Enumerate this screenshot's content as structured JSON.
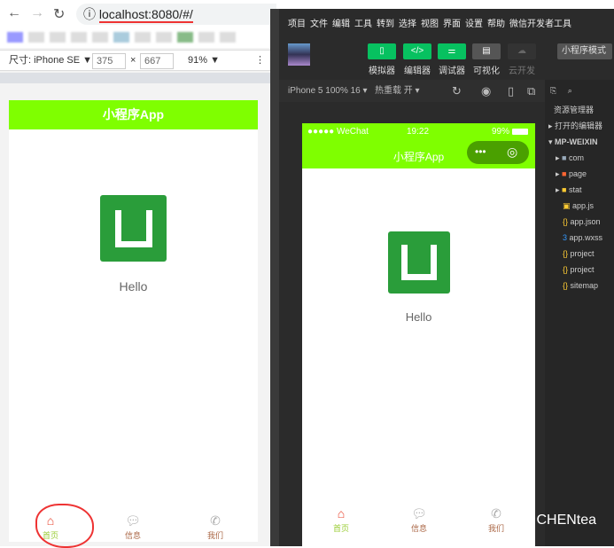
{
  "browser": {
    "url": "localhost:8080/#/",
    "device_label": "尺寸: iPhone SE ▼",
    "width": "375",
    "times": "×",
    "height": "667",
    "zoom": "91% ▼",
    "more": "⋮"
  },
  "app": {
    "title": "小程序App",
    "hello": "Hello",
    "tabs": [
      {
        "label": "首页",
        "icon": "home-icon"
      },
      {
        "label": "信息",
        "icon": "chat-icon"
      },
      {
        "label": "我们",
        "icon": "phone-icon"
      }
    ]
  },
  "ide": {
    "menu": [
      "项目",
      "文件",
      "编辑",
      "工具",
      "转到",
      "选择",
      "视图",
      "界面",
      "设置",
      "帮助",
      "微信开发者工具"
    ],
    "tools": [
      {
        "label": "模拟器",
        "glyph": "▯"
      },
      {
        "label": "编辑器",
        "glyph": "</>"
      },
      {
        "label": "调试器",
        "glyph": "⚌"
      },
      {
        "label": "可视化",
        "glyph": "▤"
      },
      {
        "label": "云开发",
        "glyph": "☁"
      }
    ],
    "mode": "小程序模式",
    "device": "iPhone 5 100% 16 ▾",
    "hotreload": "热重载 开 ▾",
    "status": {
      "carrier": "●●●●● WeChat",
      "time": "19:22",
      "battery": "99%"
    },
    "explorer": "资源管理器",
    "open_editors": "打开的编辑器",
    "project": "MP-WEIXIN",
    "files": [
      "com",
      "page",
      "stat",
      "app.js",
      "app.json",
      "app.wxss",
      "project",
      "project",
      "sitemap"
    ]
  },
  "watermark": "CHENtea"
}
